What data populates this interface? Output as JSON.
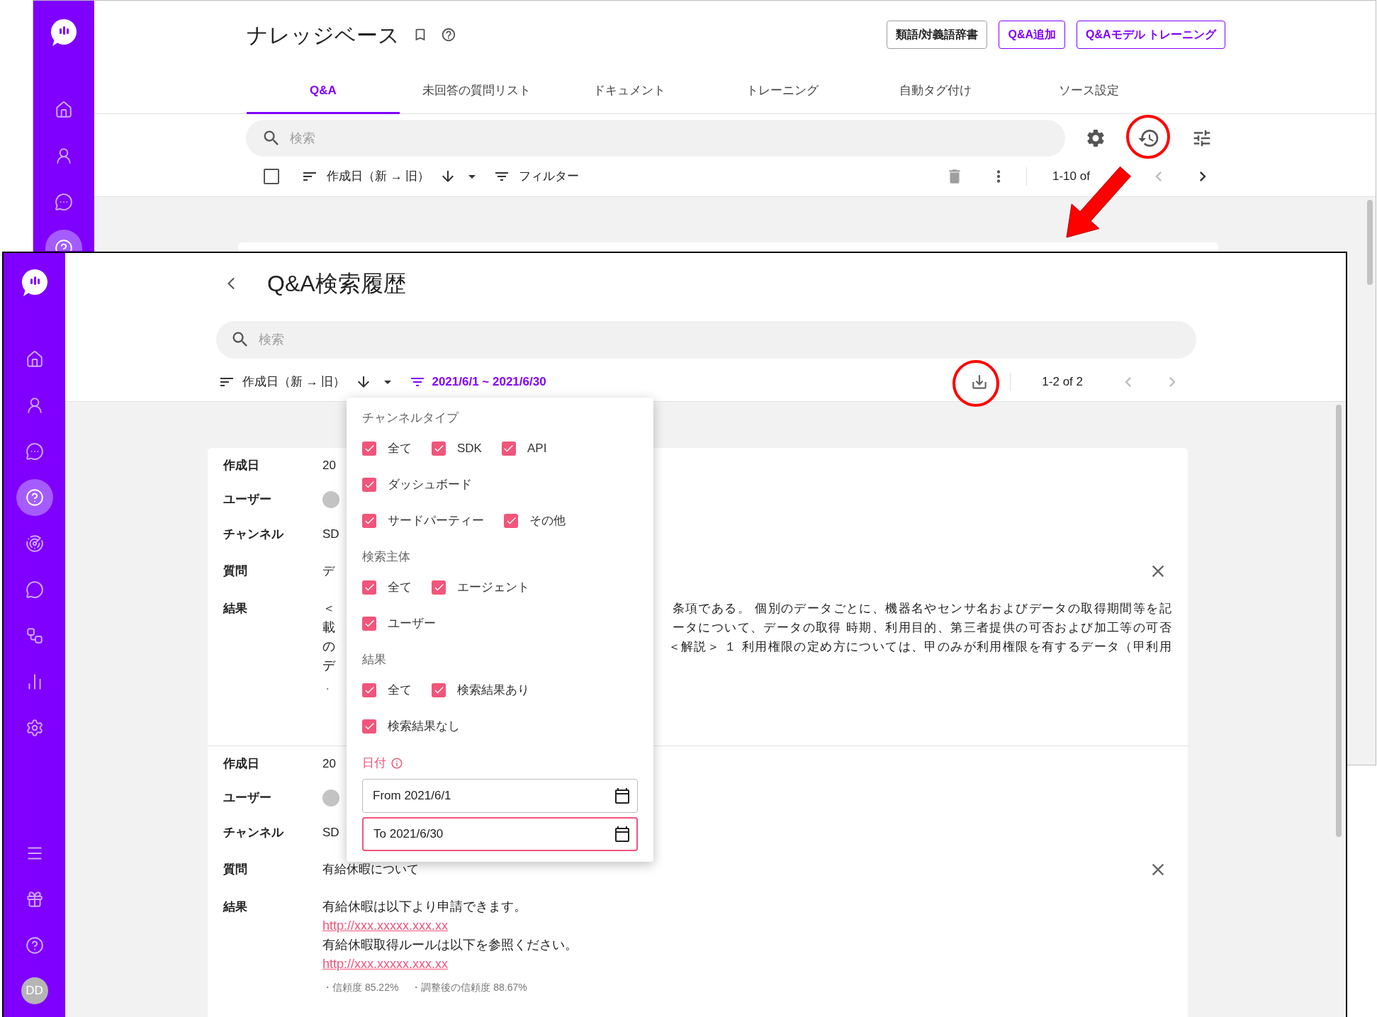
{
  "back_window": {
    "sidebar": {
      "items": [
        {
          "kind": "home",
          "selected": false
        },
        {
          "kind": "user",
          "selected": false
        },
        {
          "kind": "chat",
          "selected": false
        },
        {
          "kind": "help",
          "selected": true
        }
      ]
    },
    "title": "ナレッジベース",
    "header_buttons": [
      {
        "label": "類語/対義語辞書",
        "kind": "neutral"
      },
      {
        "label": "Q&A追加",
        "kind": "accent"
      },
      {
        "label": "Q&Aモデル トレーニング",
        "kind": "accent"
      }
    ],
    "tabs": [
      {
        "label": "Q&A",
        "selected": true
      },
      {
        "label": "未回答の質問リスト",
        "selected": false
      },
      {
        "label": "ドキュメント",
        "selected": false
      },
      {
        "label": "トレーニング",
        "selected": false
      },
      {
        "label": "自動タグ付け",
        "selected": false
      },
      {
        "label": "ソース設定",
        "selected": false
      }
    ],
    "search": {
      "placeholder": "検索"
    },
    "select_all": {
      "checked": false
    },
    "sort": {
      "label": "作成日（新 → 旧）"
    },
    "filter": {
      "label": "フィルター"
    },
    "pagination": "1-10 of"
  },
  "front_window": {
    "sidebar": {
      "items": [
        {
          "kind": "home",
          "selected": false
        },
        {
          "kind": "user",
          "selected": false
        },
        {
          "kind": "chat",
          "selected": false
        },
        {
          "kind": "help",
          "selected": true
        },
        {
          "kind": "radar",
          "selected": false
        },
        {
          "kind": "bot",
          "selected": false
        },
        {
          "kind": "flow",
          "selected": false
        },
        {
          "kind": "chart",
          "selected": false
        },
        {
          "kind": "settings",
          "selected": false
        }
      ],
      "bottom_items": [
        {
          "kind": "menu",
          "selected": false
        },
        {
          "kind": "gift",
          "selected": false
        },
        {
          "kind": "support",
          "selected": false
        }
      ],
      "avatar": "DD"
    },
    "title": "Q&A検索履歴",
    "search": {
      "placeholder": "検索"
    },
    "sort": {
      "label": "作成日（新 → 旧）"
    },
    "date_range": "2021/6/1 ~ 2021/6/30",
    "pagination": "1-2 of 2",
    "records": [
      {
        "fields": [
          {
            "label": "作成日",
            "kind": "text",
            "value": "20"
          },
          {
            "label": "ユーザー",
            "kind": "avatar"
          },
          {
            "label": "チャンネル",
            "kind": "text",
            "value": "SD"
          },
          {
            "label": "質問",
            "kind": "text",
            "value": "デ"
          }
        ],
        "result_label": "結果",
        "result_lines": [
          {
            "kind": "split",
            "left": "＜",
            "right": "条項である。 個別のデータごとに、機器名やセンサ名およびデータの取得期間等を記"
          },
          {
            "kind": "split",
            "left": "載",
            "right": "ータについて、データの取得 時期、利用目的、第三者提供の可否および加工等の可否"
          },
          {
            "kind": "split",
            "left": "の",
            "right": "＜解説＞ １ 利用権限の定め方については、甲のみが利用権限を有するデータ（甲利用"
          },
          {
            "kind": "text",
            "text": "デ"
          }
        ],
        "notes": [
          "・"
        ]
      },
      {
        "fields": [
          {
            "label": "作成日",
            "kind": "text",
            "value": "20"
          },
          {
            "label": "ユーザー",
            "kind": "avatar"
          },
          {
            "label": "チャンネル",
            "kind": "text",
            "value": "SD"
          },
          {
            "label": "質問",
            "kind": "text",
            "value": "有給休暇について"
          }
        ],
        "result_label": "結果",
        "result_lines": [
          {
            "kind": "text",
            "text": "有給休暇は以下より申請できます。"
          },
          {
            "kind": "link",
            "text": "http://xxx.xxxxx.xxx.xx"
          },
          {
            "kind": "text",
            "text": "有給休暇取得ルールは以下を参照ください。"
          },
          {
            "kind": "link",
            "text": "http://xxx.xxxxx.xxx.xx"
          }
        ],
        "notes": [
          "・信頼度 85.22%",
          "・調整後の信頼度 88.67%"
        ]
      }
    ],
    "filter_menu": {
      "sections": [
        {
          "title": "チャンネルタイプ",
          "rows": [
            {
              "options": [
                {
                  "label": "全て",
                  "checked": true
                },
                {
                  "label": "SDK",
                  "checked": true
                },
                {
                  "label": "API",
                  "checked": true
                }
              ]
            },
            {
              "options": [
                {
                  "label": "ダッシュボード",
                  "checked": true
                }
              ]
            },
            {
              "options": [
                {
                  "label": "サードパーティー",
                  "checked": true
                },
                {
                  "label": "その他",
                  "checked": true
                }
              ]
            }
          ]
        },
        {
          "title": "検索主体",
          "rows": [
            {
              "options": [
                {
                  "label": "全て",
                  "checked": true
                },
                {
                  "label": "エージェント",
                  "checked": true
                }
              ]
            },
            {
              "options": [
                {
                  "label": "ユーザー",
                  "checked": true
                }
              ]
            }
          ]
        },
        {
          "title": "結果",
          "rows": [
            {
              "options": [
                {
                  "label": "全て",
                  "checked": true
                },
                {
                  "label": "検索結果あり",
                  "checked": true
                }
              ]
            },
            {
              "options": [
                {
                  "label": "検索結果なし",
                  "checked": true
                }
              ]
            }
          ]
        }
      ],
      "date": {
        "title": "日付",
        "fields": [
          {
            "value": "From 2021/6/1",
            "focused": false
          },
          {
            "value": "To 2021/6/30",
            "focused": true
          }
        ]
      }
    }
  }
}
